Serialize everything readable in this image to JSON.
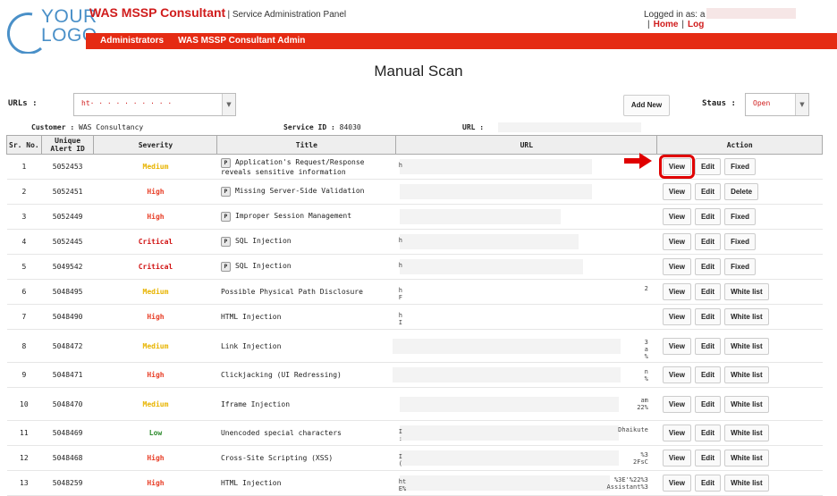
{
  "logo": {
    "line1": "YOUR",
    "line2": "LOGO"
  },
  "header": {
    "brand": "WAS MSSP Consultant",
    "subtitle": "| Service Administration Panel",
    "login_label": "Logged in as: a",
    "home_link": "Home",
    "logout_link": "Log"
  },
  "nav": {
    "items": [
      "Administrators",
      "WAS MSSP Consultant Admin"
    ]
  },
  "page": {
    "title": "Manual Scan"
  },
  "filters": {
    "urls_label": "URLs :",
    "urls_value": "ht·  ·  ·  ·  ·  ·  ·  ·  ·  ·",
    "add_new": "Add New",
    "status_label": "Staus :",
    "status_value": "Open"
  },
  "info": {
    "customer_label": "Customer :",
    "customer_value": "WAS Consultancy",
    "service_label": "Service ID :",
    "service_value": "84030",
    "url_label": "URL :"
  },
  "table": {
    "headers": [
      "Sr. No.",
      "Unique Alert ID",
      "Severity",
      "Title",
      "URL",
      "Action"
    ],
    "rows": [
      {
        "sr": "1",
        "id": "5052453",
        "severity": "Medium",
        "p": true,
        "title": "Application's Request/Response reveals sensitive information",
        "url_left": "h",
        "url_right": "",
        "actions": [
          "View",
          "Edit",
          "Fixed"
        ]
      },
      {
        "sr": "2",
        "id": "5052451",
        "severity": "High",
        "p": true,
        "title": "Missing Server-Side Validation",
        "url_left": "",
        "url_right": "",
        "actions": [
          "View",
          "Edit",
          "Delete"
        ]
      },
      {
        "sr": "3",
        "id": "5052449",
        "severity": "High",
        "p": true,
        "title": "Improper Session Management",
        "url_left": "",
        "url_right": "",
        "actions": [
          "View",
          "Edit",
          "Fixed"
        ]
      },
      {
        "sr": "4",
        "id": "5052445",
        "severity": "Critical",
        "p": true,
        "title": "SQL Injection",
        "url_left": "h",
        "url_right": "",
        "actions": [
          "View",
          "Edit",
          "Fixed"
        ]
      },
      {
        "sr": "5",
        "id": "5049542",
        "severity": "Critical",
        "p": true,
        "title": "SQL Injection",
        "url_left": "h",
        "url_right": "",
        "actions": [
          "View",
          "Edit",
          "Fixed"
        ]
      },
      {
        "sr": "6",
        "id": "5048495",
        "severity": "Medium",
        "p": false,
        "title": "Possible Physical Path Disclosure",
        "url_left": "h\nF",
        "url_right": "2",
        "actions": [
          "View",
          "Edit",
          "White list"
        ]
      },
      {
        "sr": "7",
        "id": "5048490",
        "severity": "High",
        "p": false,
        "title": "HTML Injection",
        "url_left": "h\nI",
        "url_right": "",
        "actions": [
          "View",
          "Edit",
          "White list"
        ]
      },
      {
        "sr": "8",
        "id": "5048472",
        "severity": "Medium",
        "p": false,
        "title": "Link Injection",
        "url_left": "",
        "url_right": "3\na\n%",
        "actions": [
          "View",
          "Edit",
          "White list"
        ]
      },
      {
        "sr": "9",
        "id": "5048471",
        "severity": "High",
        "p": false,
        "title": "Clickjacking (UI Redressing)",
        "url_left": "",
        "url_right": "n\n%",
        "actions": [
          "View",
          "Edit",
          "White list"
        ]
      },
      {
        "sr": "10",
        "id": "5048470",
        "severity": "Medium",
        "p": false,
        "title": "Iframe Injection",
        "url_left": "",
        "url_right": "am\n22%",
        "actions": [
          "View",
          "Edit",
          "White list"
        ]
      },
      {
        "sr": "11",
        "id": "5048469",
        "severity": "Low",
        "p": false,
        "title": "Unencoded special characters",
        "url_left": "I\n:",
        "url_right": "Dhaikute",
        "actions": [
          "View",
          "Edit",
          "White list"
        ]
      },
      {
        "sr": "12",
        "id": "5048468",
        "severity": "High",
        "p": false,
        "title": "Cross-Site Scripting (XSS)",
        "url_left": "I\n(",
        "url_right": "%3\n2FsC",
        "actions": [
          "View",
          "Edit",
          "White list"
        ]
      },
      {
        "sr": "13",
        "id": "5048259",
        "severity": "High",
        "p": false,
        "title": "HTML Injection",
        "url_left": "ht\nE%",
        "url_right": "%3E'%22%3\nAssistant%3",
        "actions": [
          "View",
          "Edit",
          "White list"
        ]
      }
    ]
  },
  "colors": {
    "brand_red": "#d01c1c",
    "nav_red": "#e52b13",
    "medium": "#e8b400",
    "high": "#e8412a",
    "critical": "#d01010",
    "low": "#2e8b2e",
    "logo_blue": "#4a90c8"
  },
  "icons": {
    "pointer": "arrow-right-icon",
    "dropdown": "chevron-down-icon",
    "p_badge": "p-badge-icon"
  }
}
